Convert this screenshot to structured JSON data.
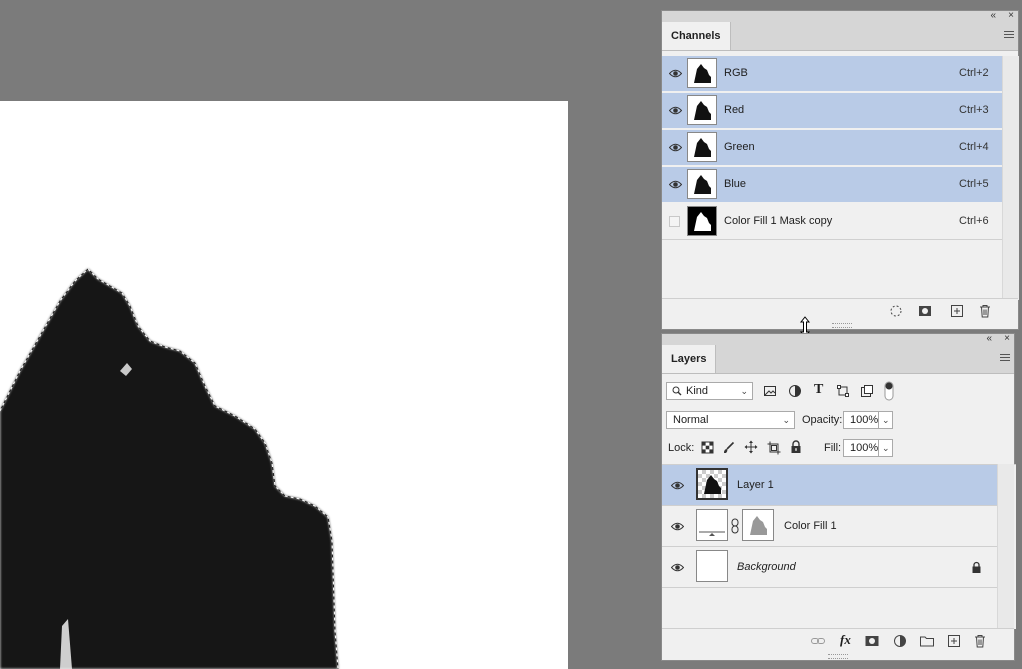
{
  "channels_panel": {
    "tab_label": "Channels",
    "collapse_glyph": "«",
    "close_glyph": "×",
    "channels": [
      {
        "name": "RGB",
        "shortcut": "Ctrl+2",
        "selected": true,
        "visible": true
      },
      {
        "name": "Red",
        "shortcut": "Ctrl+3",
        "selected": true,
        "visible": true
      },
      {
        "name": "Green",
        "shortcut": "Ctrl+4",
        "selected": true,
        "visible": true
      },
      {
        "name": "Blue",
        "shortcut": "Ctrl+5",
        "selected": true,
        "visible": true
      },
      {
        "name": "Color Fill 1 Mask copy",
        "shortcut": "Ctrl+6",
        "selected": false,
        "visible": false
      }
    ],
    "footer_icons": [
      "load-selection-icon",
      "save-selection-icon",
      "new-channel-icon",
      "delete-icon"
    ]
  },
  "layers_panel": {
    "tab_label": "Layers",
    "collapse_glyph": "«",
    "close_glyph": "×",
    "filter": {
      "value": "Kind",
      "icons": [
        "image-filter-icon",
        "adjustment-filter-icon",
        "type-filter-icon",
        "shape-filter-icon",
        "smart-object-filter-icon",
        "filter-toggle-icon"
      ]
    },
    "blend_mode": "Normal",
    "opacity_label": "Opacity:",
    "opacity_value": "100%",
    "lock_label": "Lock:",
    "fill_label": "Fill:",
    "fill_value": "100%",
    "layers": [
      {
        "name": "Layer 1",
        "selected": true,
        "italic": false
      },
      {
        "name": "Color Fill 1",
        "selected": false,
        "italic": false
      },
      {
        "name": "Background",
        "selected": false,
        "italic": true
      }
    ],
    "footer_icons": [
      "link-icon",
      "fx-icon",
      "mask-icon",
      "adjustment-icon",
      "group-folder-icon",
      "new-layer-icon",
      "delete-icon"
    ],
    "fx_label": "fx"
  },
  "colors": {
    "workspace": "#7b7b7b",
    "panel_bg": "#f0f0f0",
    "selection": "#b9cbe7",
    "brush": "#161616"
  }
}
